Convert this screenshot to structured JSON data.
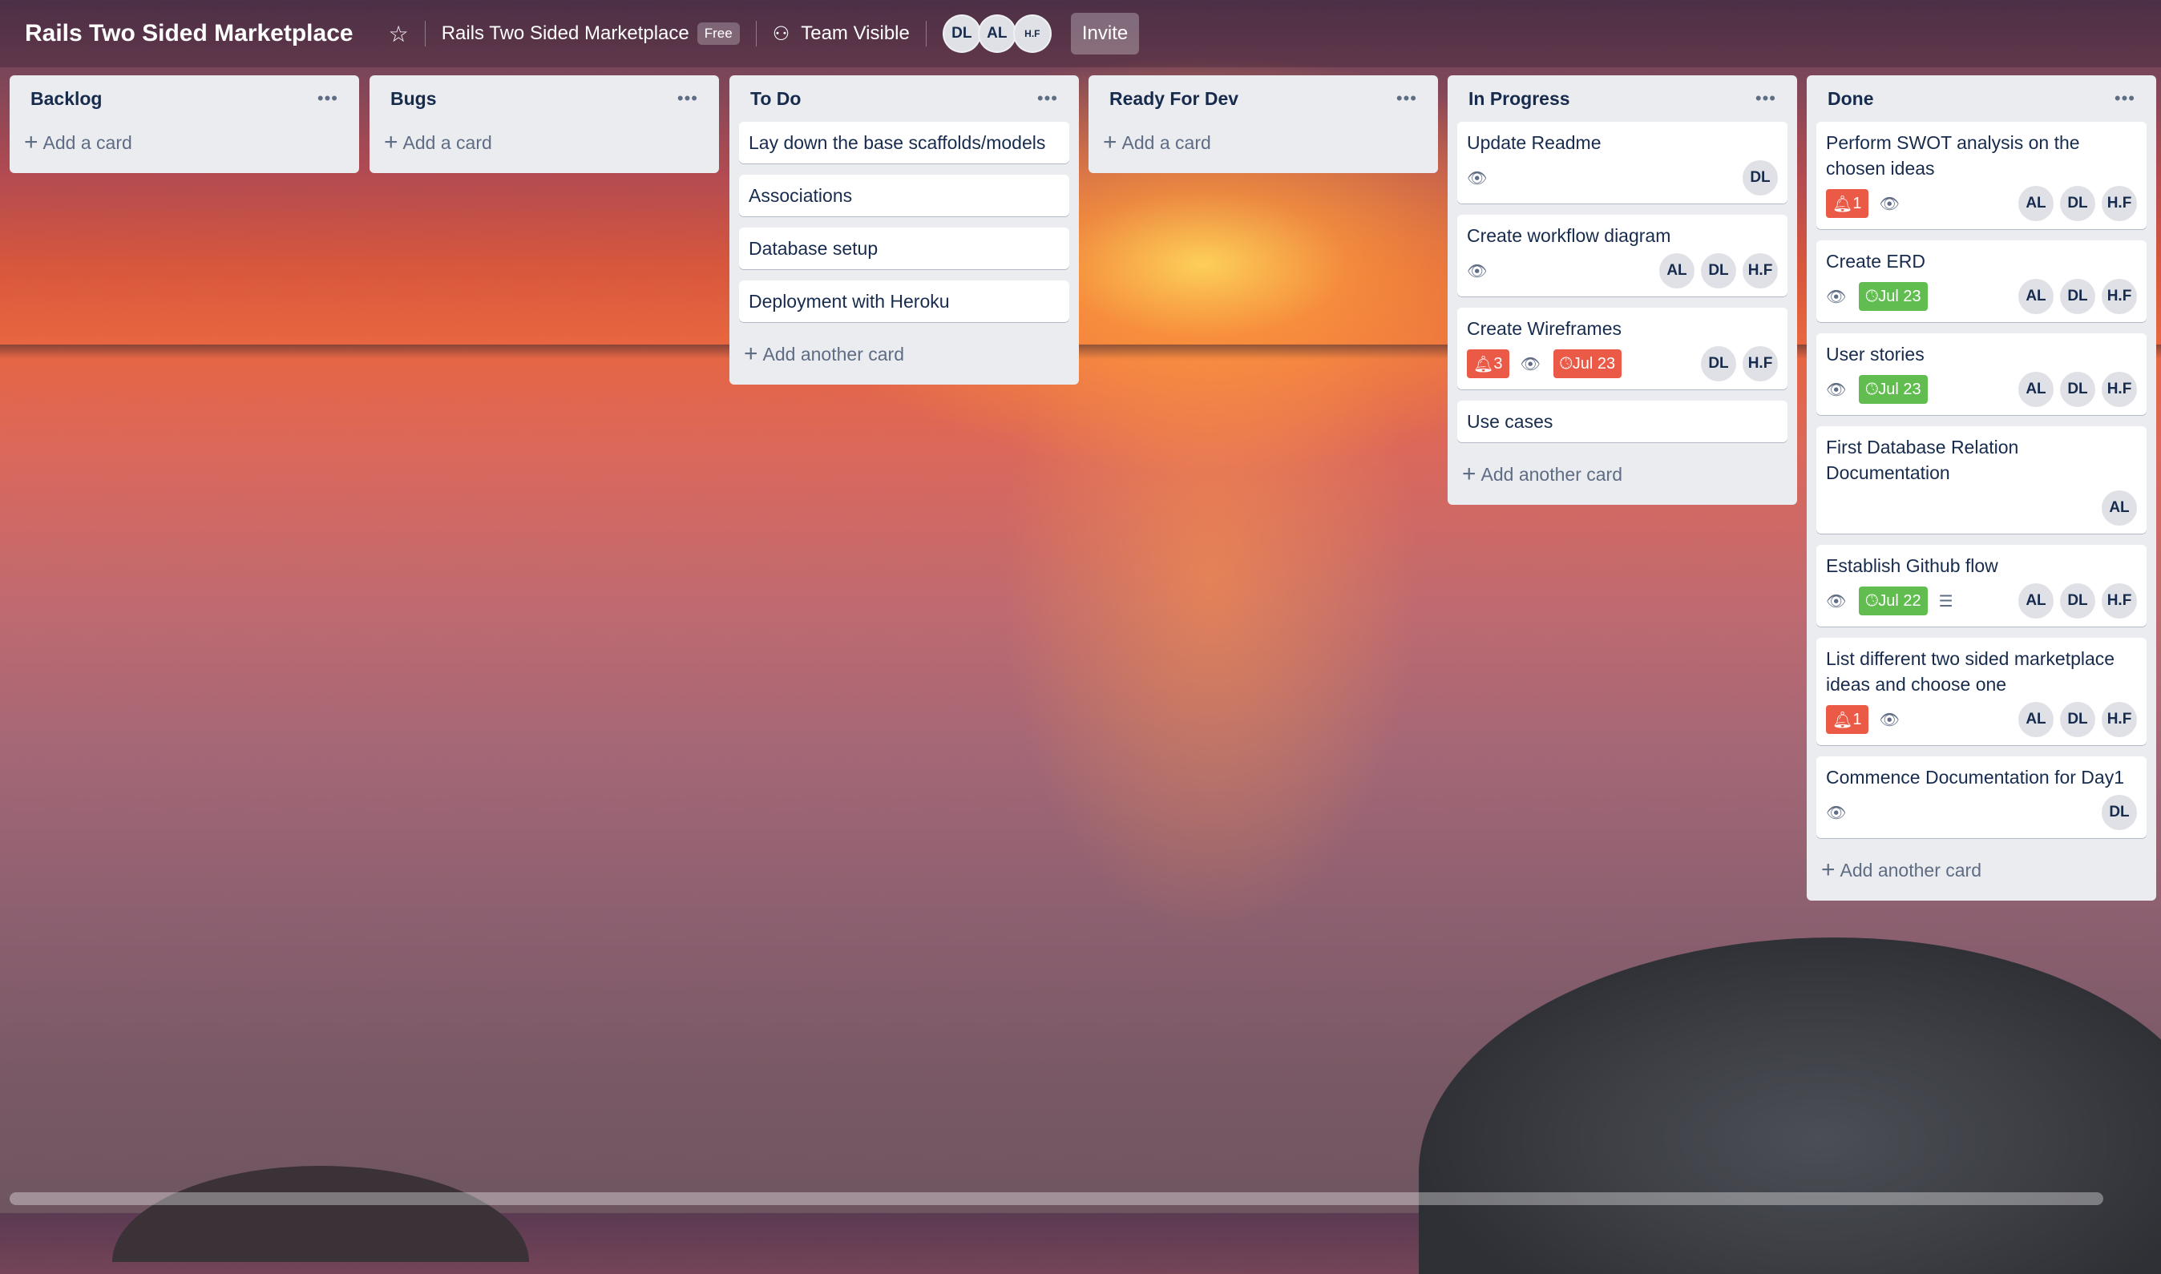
{
  "header": {
    "board_title": "Rails Two Sided Marketplace",
    "workspace_name": "Rails Two Sided Marketplace",
    "workspace_badge": "Free",
    "visibility": "Team Visible",
    "members": [
      "DL",
      "AL",
      "H.F"
    ],
    "invite_label": "Invite"
  },
  "lists": [
    {
      "title": "Backlog",
      "add_label": "Add a card",
      "cards": []
    },
    {
      "title": "Bugs",
      "add_label": "Add a card",
      "cards": []
    },
    {
      "title": "To Do",
      "add_label": "Add another card",
      "cards": [
        {
          "title": "Lay down the base scaffolds/models"
        },
        {
          "title": "Associations"
        },
        {
          "title": "Database setup"
        },
        {
          "title": "Deployment with Heroku"
        }
      ]
    },
    {
      "title": "Ready For Dev",
      "add_label": "Add a card",
      "cards": []
    },
    {
      "title": "In Progress",
      "add_label": "Add another card",
      "cards": [
        {
          "title": "Update Readme",
          "watch": true,
          "members": [
            "DL"
          ]
        },
        {
          "title": "Create workflow diagram",
          "watch": true,
          "members": [
            "AL",
            "DL",
            "H.F"
          ]
        },
        {
          "title": "Create Wireframes",
          "alert": "3",
          "watch": true,
          "due": "Jul 23",
          "due_color": "#eb5a46",
          "members": [
            "DL",
            "H.F"
          ]
        },
        {
          "title": "Use cases"
        }
      ]
    },
    {
      "title": "Done",
      "add_label": "Add another card",
      "cards": [
        {
          "title": "Perform SWOT analysis on the chosen ideas",
          "alert": "1",
          "watch": true,
          "members": [
            "AL",
            "DL",
            "H.F"
          ]
        },
        {
          "title": "Create ERD",
          "watch": true,
          "due": "Jul 23",
          "due_color": "#61bd4f",
          "members": [
            "AL",
            "DL",
            "H.F"
          ]
        },
        {
          "title": "User stories",
          "watch": true,
          "due": "Jul 23",
          "due_color": "#61bd4f",
          "members": [
            "AL",
            "DL",
            "H.F"
          ]
        },
        {
          "title": "First Database Relation Documentation",
          "members": [
            "AL"
          ]
        },
        {
          "title": "Establish Github flow",
          "watch": true,
          "due": "Jul 22",
          "due_color": "#61bd4f",
          "description": true,
          "members": [
            "AL",
            "DL",
            "H.F"
          ]
        },
        {
          "title": "List different two sided marketplace ideas and choose one",
          "alert": "1",
          "watch": true,
          "members": [
            "AL",
            "DL",
            "H.F"
          ]
        },
        {
          "title": "Commence Documentation for Day1",
          "watch": true,
          "members": [
            "DL"
          ]
        }
      ]
    }
  ],
  "colors": {
    "alert": "#eb5a46",
    "due_ok": "#61bd4f",
    "list_bg": "#ebecf0"
  }
}
